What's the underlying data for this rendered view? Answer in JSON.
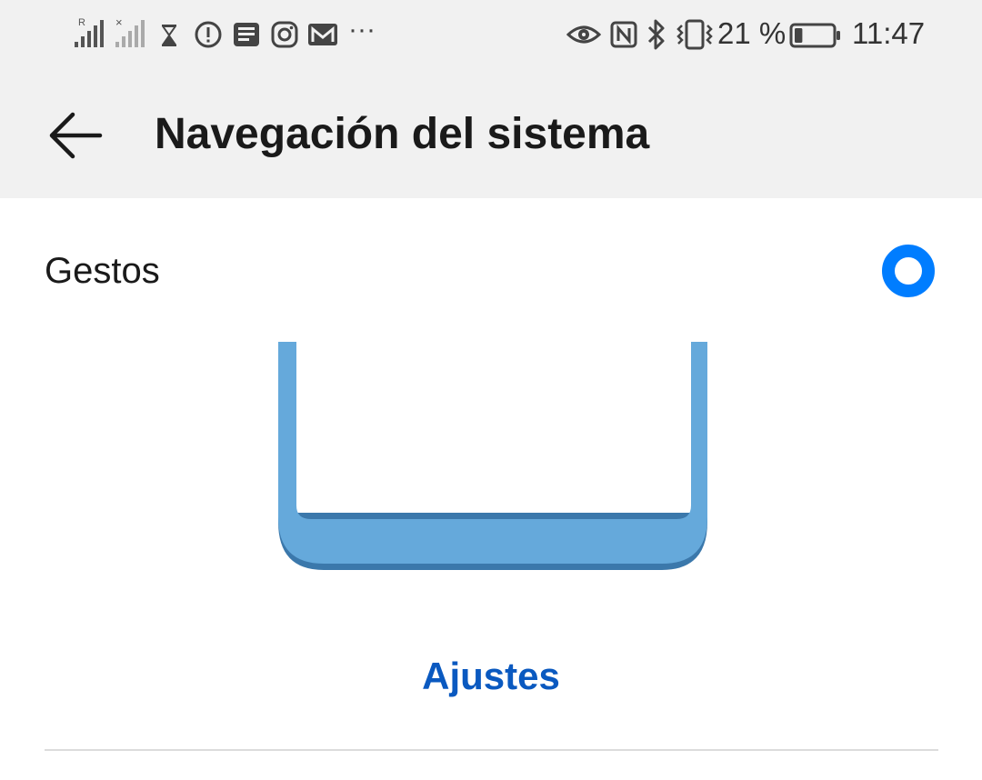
{
  "status_bar": {
    "battery_percent": "21 %",
    "time": "11:47",
    "battery_level": 0.21,
    "icons": [
      "signal-icon",
      "signal-off-icon",
      "hourglass-icon",
      "alert-icon",
      "news-icon",
      "instagram-icon",
      "gmail-icon",
      "more-icon",
      "eye-icon",
      "nfc-icon",
      "bluetooth-icon",
      "vibrate-icon",
      "battery-icon"
    ],
    "more_label": "···"
  },
  "header": {
    "title": "Navegación del sistema",
    "back_icon": "back-arrow-icon"
  },
  "option": {
    "label": "Gestos",
    "selected": true
  },
  "settings_link": "Ajustes",
  "colors": {
    "accent": "#007dff",
    "link": "#0a59c0",
    "illustration": "#65a9db",
    "illustration_shadow": "#3b78ab",
    "header_bg": "#f1f1f1"
  }
}
